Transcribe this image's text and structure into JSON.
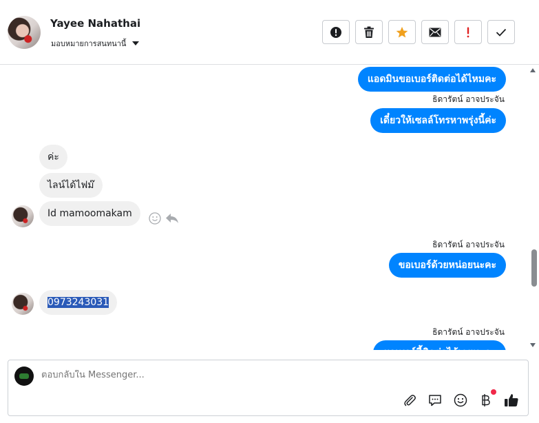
{
  "contact": {
    "name": "Yayee Nahathai",
    "assign_label": "มอบหมายการสนทนานี้"
  },
  "actions": [
    {
      "name": "alert-button",
      "icon": "alert-circle-icon"
    },
    {
      "name": "delete-button",
      "icon": "trash-icon"
    },
    {
      "name": "star-button",
      "icon": "star-icon",
      "color": "#f0a01e"
    },
    {
      "name": "mail-button",
      "icon": "envelope-icon"
    },
    {
      "name": "spam-button",
      "icon": "exclamation-icon",
      "color": "#e02020"
    },
    {
      "name": "done-button",
      "icon": "check-icon"
    }
  ],
  "messages": {
    "out_1": "แอดมินขอเบอร์ติดต่อได้ไหมคะ",
    "sender_1": "ธิดารัตน์ อาจประจัน",
    "out_2": "เดี๋ยวให้เซลล์โทรหาพรุ่งนี้ค่ะ",
    "in_1": "ค่ะ",
    "in_2": "ไลน์ได้ไฟม๊",
    "in_3": "Id mamoomakam",
    "sender_2": "ธิดารัตน์ อาจประจัน",
    "out_3": "ขอเบอร์ด้วยหน่อยนะคะ",
    "in_4": "0973243031",
    "sender_3": "ธิดารัตน์ อาจประจัน",
    "out_4": "ขอเบอร์นี้ติดต่อได้เลยนะคะ"
  },
  "composer": {
    "placeholder": "ตอบกลับใน Messenger..."
  },
  "colors": {
    "outgoing_bubble": "#0084ff",
    "incoming_bubble": "#f0f0f0",
    "selection": "#2a5ab8"
  }
}
